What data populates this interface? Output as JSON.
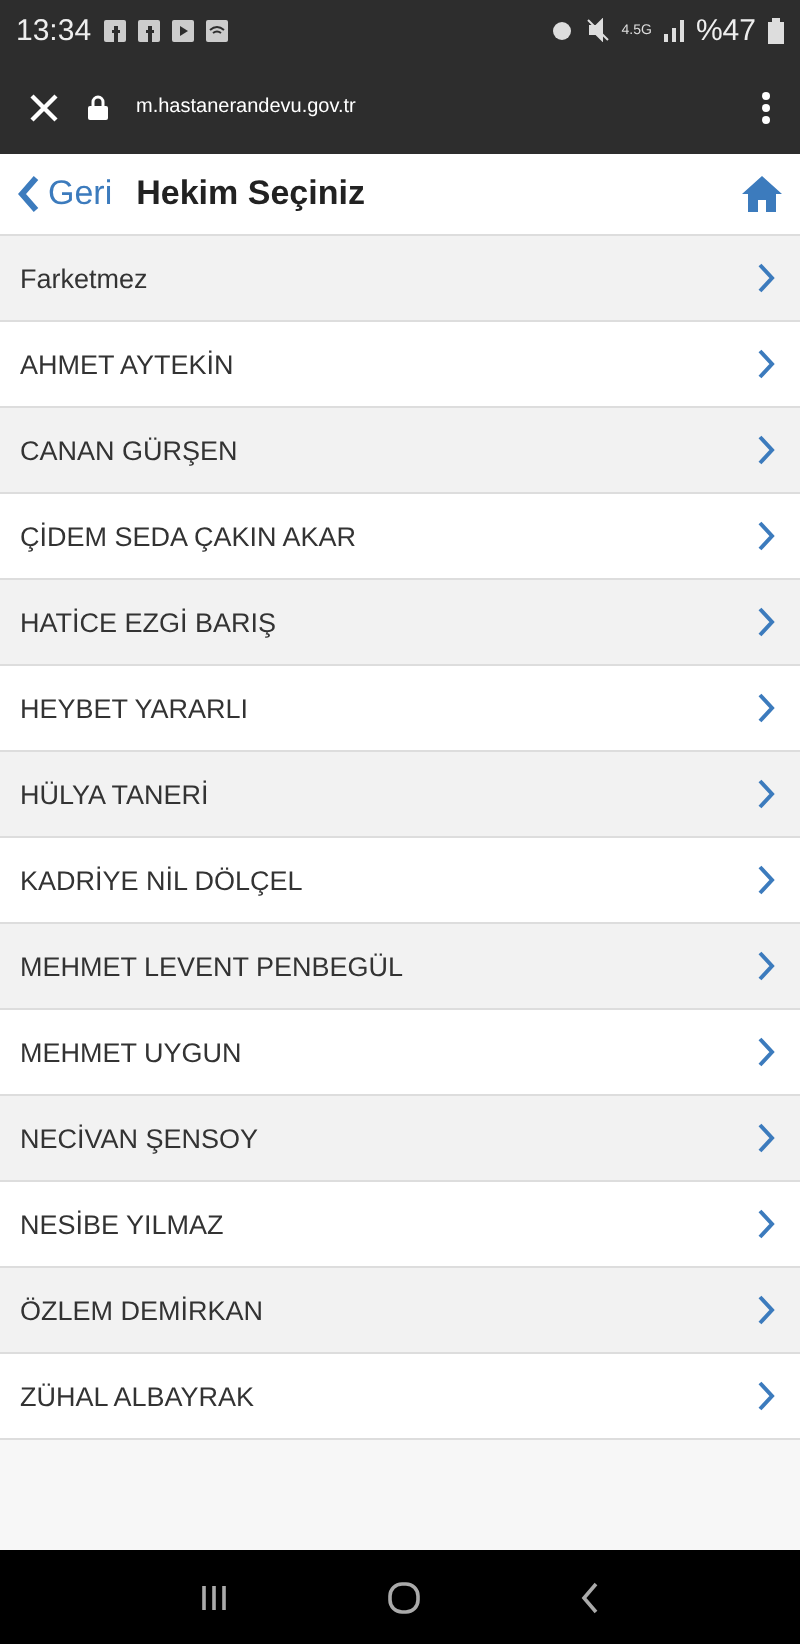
{
  "status_bar": {
    "time": "13:34",
    "network": "4.5G",
    "battery": "%47"
  },
  "browser": {
    "url": "m.hastanerandevu.gov.tr"
  },
  "header": {
    "back": "Geri",
    "title": "Hekim Seçiniz"
  },
  "doctors": [
    {
      "name": "Farketmez"
    },
    {
      "name": "AHMET AYTEKİN"
    },
    {
      "name": "CANAN GÜRŞEN"
    },
    {
      "name": "ÇİDEM SEDA ÇAKIN AKAR"
    },
    {
      "name": "HATİCE EZGİ BARIŞ"
    },
    {
      "name": "HEYBET YARARLI"
    },
    {
      "name": "HÜLYA TANERİ"
    },
    {
      "name": "KADRİYE NİL DÖLÇEL"
    },
    {
      "name": "MEHMET LEVENT PENBEGÜL"
    },
    {
      "name": "MEHMET UYGUN"
    },
    {
      "name": "NECİVAN ŞENSOY"
    },
    {
      "name": "NESİBE YILMAZ"
    },
    {
      "name": "ÖZLEM DEMİRKAN"
    },
    {
      "name": "ZÜHAL ALBAYRAK"
    }
  ]
}
